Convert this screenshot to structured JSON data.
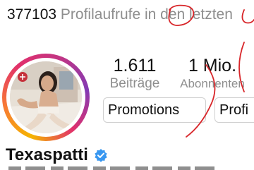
{
  "banner": {
    "views_count": "377103",
    "views_label": "Profilaufrufe in den letzten"
  },
  "stats": {
    "posts_value": "1.611",
    "posts_label": "Beiträge",
    "followers_value": "1 Mio.",
    "followers_label": "Abonnenten"
  },
  "actions": {
    "promotions_label": "Promotions",
    "profile_label": "Profi"
  },
  "profile": {
    "username": "Texaspatti"
  },
  "colors": {
    "ring_start": "#f5b400",
    "ring_mid": "#e1306c",
    "ring_end": "#833ab4",
    "verified_badge": "#3897f0",
    "annotation_ink": "#d8262a"
  },
  "icons": {
    "verified": "verified-badge-icon"
  }
}
